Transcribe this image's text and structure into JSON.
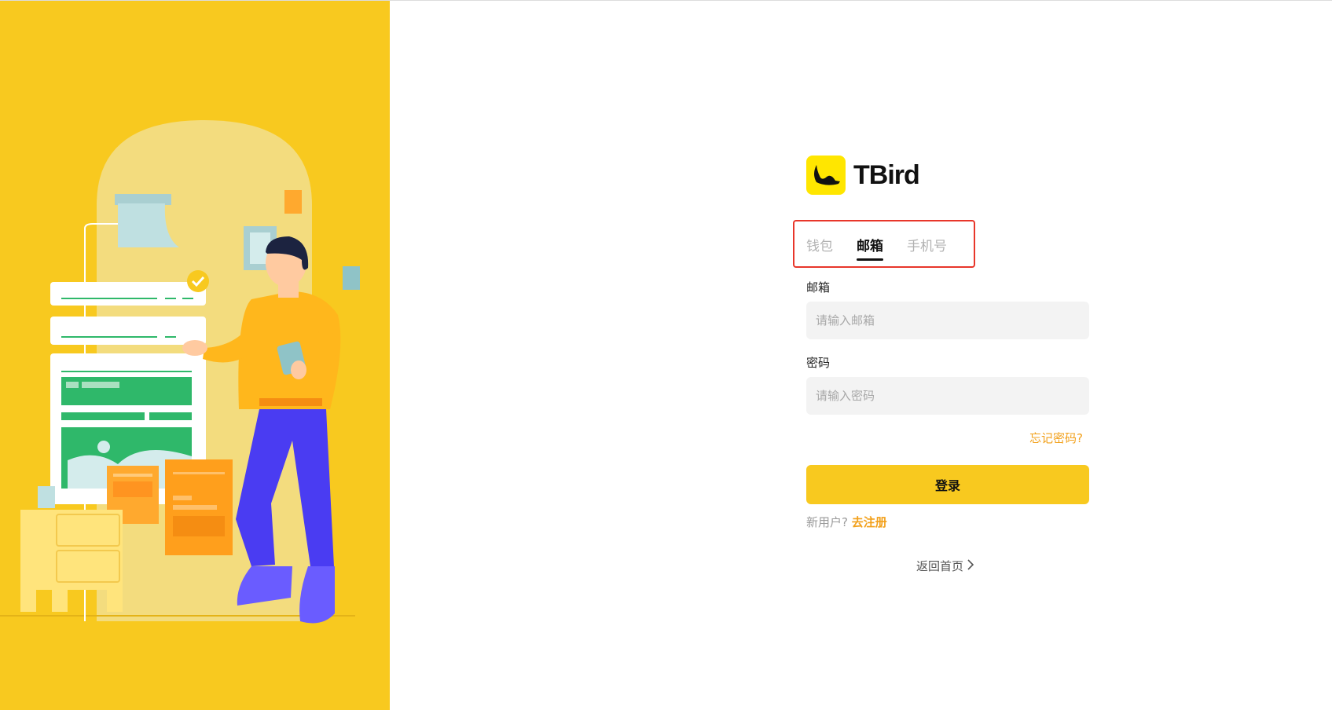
{
  "brand": {
    "name": "TBird",
    "logo_icon": "bird-logo-icon",
    "logo_color": "#ffe600"
  },
  "tabs": [
    {
      "label": "钱包",
      "active": false
    },
    {
      "label": "邮箱",
      "active": true
    },
    {
      "label": "手机号",
      "active": false
    }
  ],
  "email": {
    "label": "邮箱",
    "placeholder": "请输入邮箱",
    "value": ""
  },
  "password": {
    "label": "密码",
    "placeholder": "请输入密码",
    "value": ""
  },
  "forgot_password": "忘记密码?",
  "login_button": "登录",
  "register": {
    "prompt": "新用户?",
    "link": "去注册"
  },
  "back_home": {
    "label": "返回首页",
    "icon": "chevron-right-icon"
  },
  "colors": {
    "accent": "#f8c91f",
    "link": "#f2a01a",
    "highlight_border": "#e8362a"
  },
  "illustration": {
    "icon": "person-with-phone-illustration"
  }
}
